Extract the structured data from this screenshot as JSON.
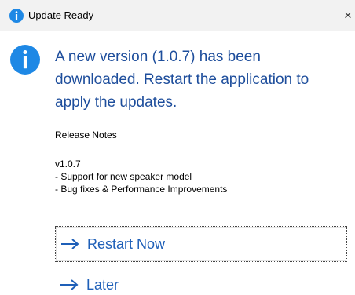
{
  "window": {
    "title": "Update Ready",
    "close_glyph": "×",
    "title_icon": "info-icon",
    "accent_color": "#1e88e5"
  },
  "message": {
    "icon": "info-icon",
    "main_instruction": "A new version (1.0.7) has been downloaded. Restart the application to apply the updates.",
    "release_notes_title": "Release Notes",
    "notes": [
      "v1.0.7",
      "- Support for new speaker model",
      "- Bug fixes & Performance Improvements"
    ]
  },
  "actions": {
    "restart_label": "Restart Now",
    "later_label": "Later",
    "arrow_icon": "arrow-right-icon",
    "link_color": "#1e5fb8"
  }
}
